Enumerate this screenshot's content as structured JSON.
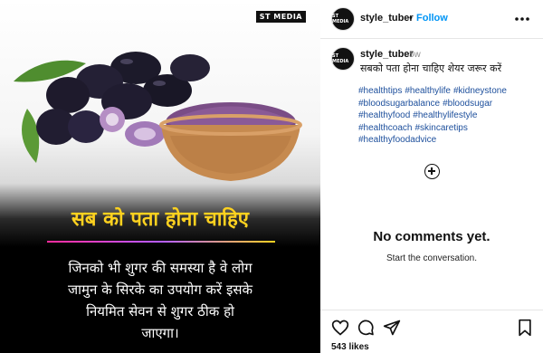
{
  "media": {
    "brand_badge": "ST MEDIA",
    "headline": "सब को पता होना चाहिए",
    "body_lines": [
      "जिनको भी शुगर की समस्या है वे लोग",
      "जामुन के सिरके का उपयोग करें इसके",
      "नियमित सेवन से शुगर ठीक हो",
      "जाएगा।"
    ],
    "colors": {
      "headline": "#ffd21f",
      "rule_pink": "#ff2b9c",
      "rule_purple": "#b45cff",
      "powder": "#7a4d86"
    }
  },
  "header": {
    "username": "style_tuber",
    "dot": "•",
    "follow_label": "Follow",
    "more_icon": "more-horizontal-icon",
    "avatar_text": "ST MEDIA"
  },
  "caption": {
    "username": "style_tuber",
    "time": "5w",
    "text": "सबको पता होना चाहिए शेयर जरूर करें",
    "hashtags": [
      "#healthtips",
      "#healthylife",
      "#kidneystone",
      "#bloodsugarbalance",
      "#bloodsugar",
      "#healthyfood",
      "#healthylifestyle",
      "#healthcoach",
      "#skincaretips",
      "#healthyfoodadvice"
    ]
  },
  "comments": {
    "empty_title": "No comments yet.",
    "empty_subtitle": "Start the conversation."
  },
  "actions": {
    "icons": [
      "heart-icon",
      "comment-icon",
      "share-icon",
      "bookmark-icon"
    ],
    "likes": "543 likes"
  }
}
